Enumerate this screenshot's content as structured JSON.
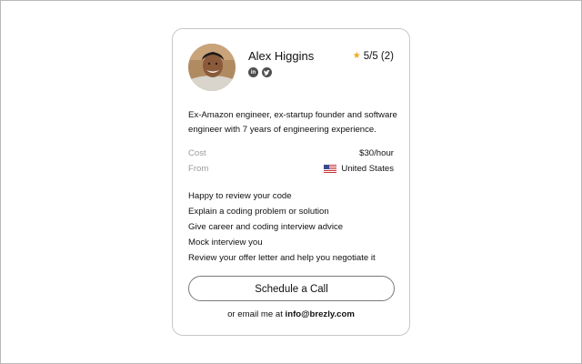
{
  "profile": {
    "name": "Alex Higgins",
    "rating": "5/5 (2)",
    "bio": "Ex-Amazon engineer, ex-startup founder and software engineer with 7 years of engineering experience.",
    "cost_label": "Cost",
    "cost_value": "$30/hour",
    "from_label": "From",
    "from_value": "United States",
    "socials": [
      {
        "icon": "linkedin-icon",
        "glyph": "in"
      },
      {
        "icon": "twitter-icon",
        "glyph": "🐦"
      }
    ]
  },
  "services": [
    "Happy to review your code",
    "Explain a coding problem or solution",
    "Give career and coding interview advice",
    "Mock interview you",
    "Review your offer letter and help you negotiate it"
  ],
  "cta": {
    "label": "Schedule a Call",
    "email_prefix": "or email me at ",
    "email": "info@brezly.com"
  },
  "colors": {
    "star": "#f2a81d",
    "muted_label": "#9a9a9a",
    "card_border": "#c8c8c8",
    "button_border": "#7a7a7a",
    "social_icon": "#4f4f4f"
  }
}
